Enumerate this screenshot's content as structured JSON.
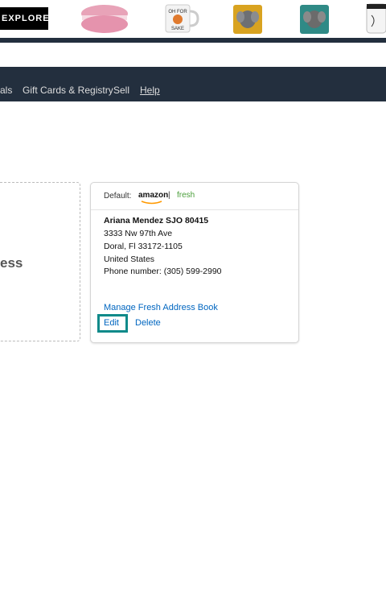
{
  "ad": {
    "explore_label": "EXPLORE",
    "products": [
      "macaron-pillow",
      "mug-oh-for-sake",
      "elephant-pillow-yellow",
      "elephant-pillow-teal",
      "travel-mug"
    ],
    "mug_text": "OH FOR\nSAKE"
  },
  "nav": {
    "items": [
      "als",
      "Gift Cards & Registry",
      "Sell",
      "Help"
    ]
  },
  "add_address": {
    "label": "ess"
  },
  "address_card": {
    "default_label": "Default:",
    "brand": "amazon",
    "separator": "|",
    "fresh": "fresh",
    "name": "Ariana Mendez SJO 80415",
    "street": "3333 Nw 97th Ave",
    "city": "Doral, Fl 33172-1105",
    "country": "United States",
    "phone": "Phone number: (305) 599-2990",
    "manage_link": "Manage Fresh Address Book",
    "edit_link": "Edit",
    "delete_link": "Delete"
  },
  "colors": {
    "nav_bg": "#232f3e",
    "link": "#0066c0",
    "highlight": "#0f8a8a",
    "fresh_green": "#4a9e3a"
  }
}
